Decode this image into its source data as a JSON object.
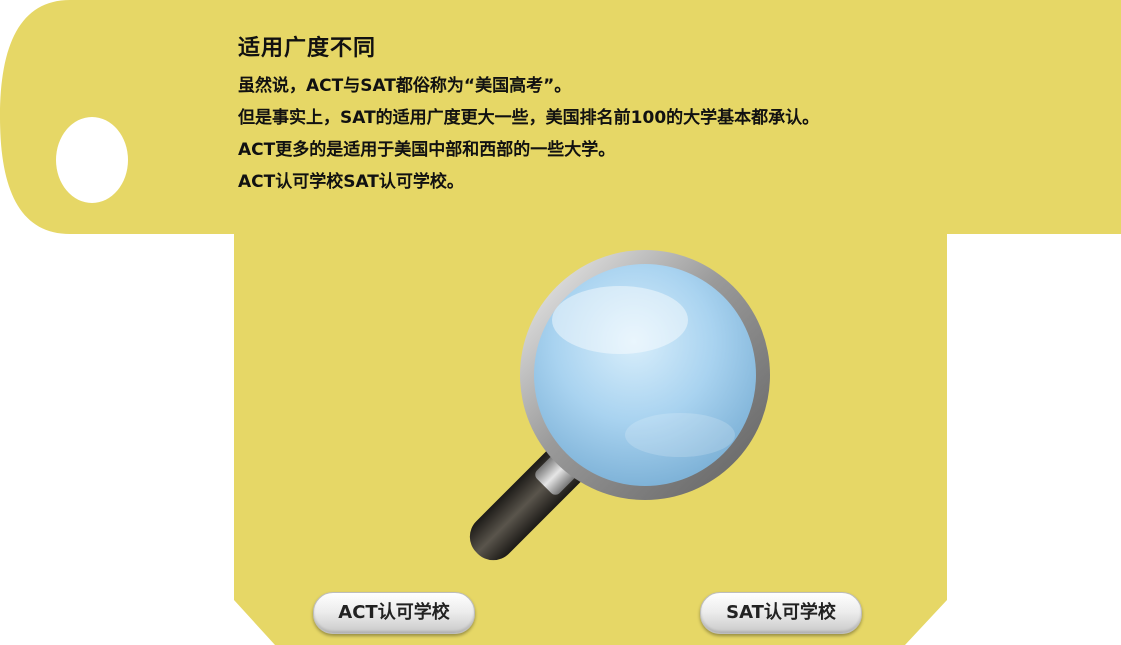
{
  "section": {
    "title": "适用广度不同",
    "lines": [
      "虽然说，ACT与SAT都俗称为“美国高考”。",
      "但是事实上，SAT的适用广度更大一些，美国排名前100的大学基本都承认。",
      "ACT更多的是适用于美国中部和西部的一些大学。",
      "ACT认可学校SAT认可学校。"
    ]
  },
  "buttons": {
    "act_label": "ACT认可学校",
    "sat_label": "SAT认可学校"
  },
  "icons": {
    "magnifier": "magnifying-glass-icon"
  },
  "colors": {
    "panel": "#e6d766",
    "text": "#111111",
    "lens": "#a9d3f0"
  }
}
